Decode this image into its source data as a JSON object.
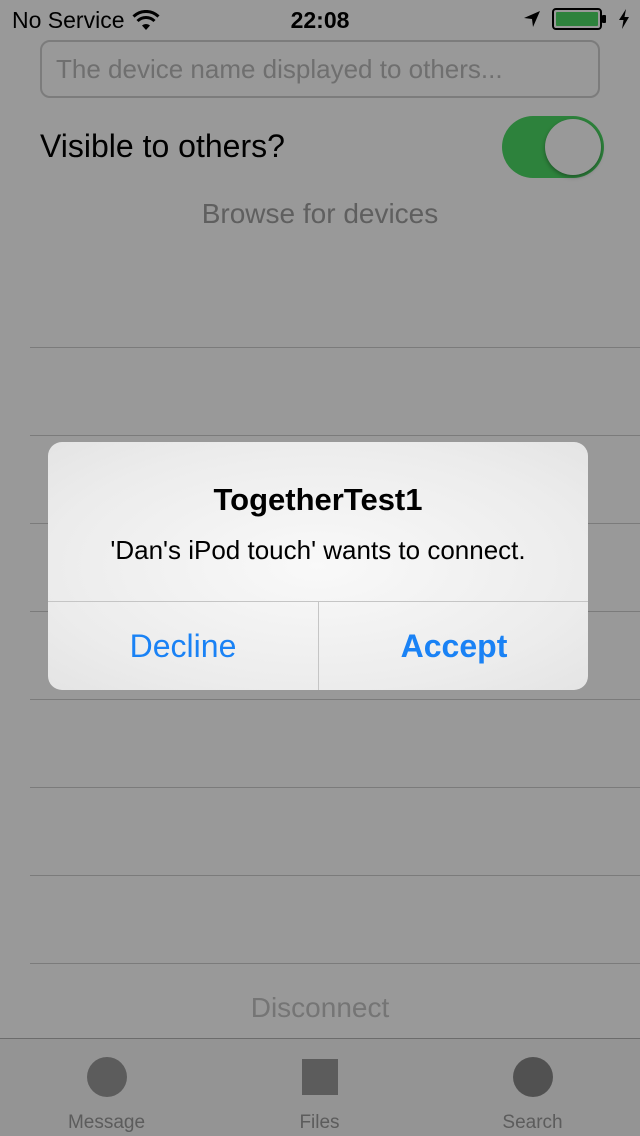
{
  "status_bar": {
    "carrier": "No Service",
    "time": "22:08",
    "icons": [
      "wifi-icon",
      "location-arrow-icon",
      "battery-icon",
      "charging-bolt-icon"
    ],
    "battery_color": "#4cd964"
  },
  "device_name": {
    "value": "",
    "placeholder": "The device name displayed to others..."
  },
  "visibility": {
    "label": "Visible to others?",
    "enabled": true,
    "on_color": "#4cd964"
  },
  "browse_label": "Browse for devices",
  "device_list": {
    "rows": []
  },
  "disconnect_label": "Disconnect",
  "tab_bar": {
    "tabs": [
      {
        "label": "Message",
        "icon": "circle-icon",
        "selected": false
      },
      {
        "label": "Files",
        "icon": "square-icon",
        "selected": false
      },
      {
        "label": "Search",
        "icon": "circle-icon",
        "selected": true
      }
    ]
  },
  "alert": {
    "title": "TogetherTest1",
    "message": "'Dan's iPod touch' wants to connect.",
    "decline_label": "Decline",
    "accept_label": "Accept",
    "button_color": "#1a82f5"
  }
}
